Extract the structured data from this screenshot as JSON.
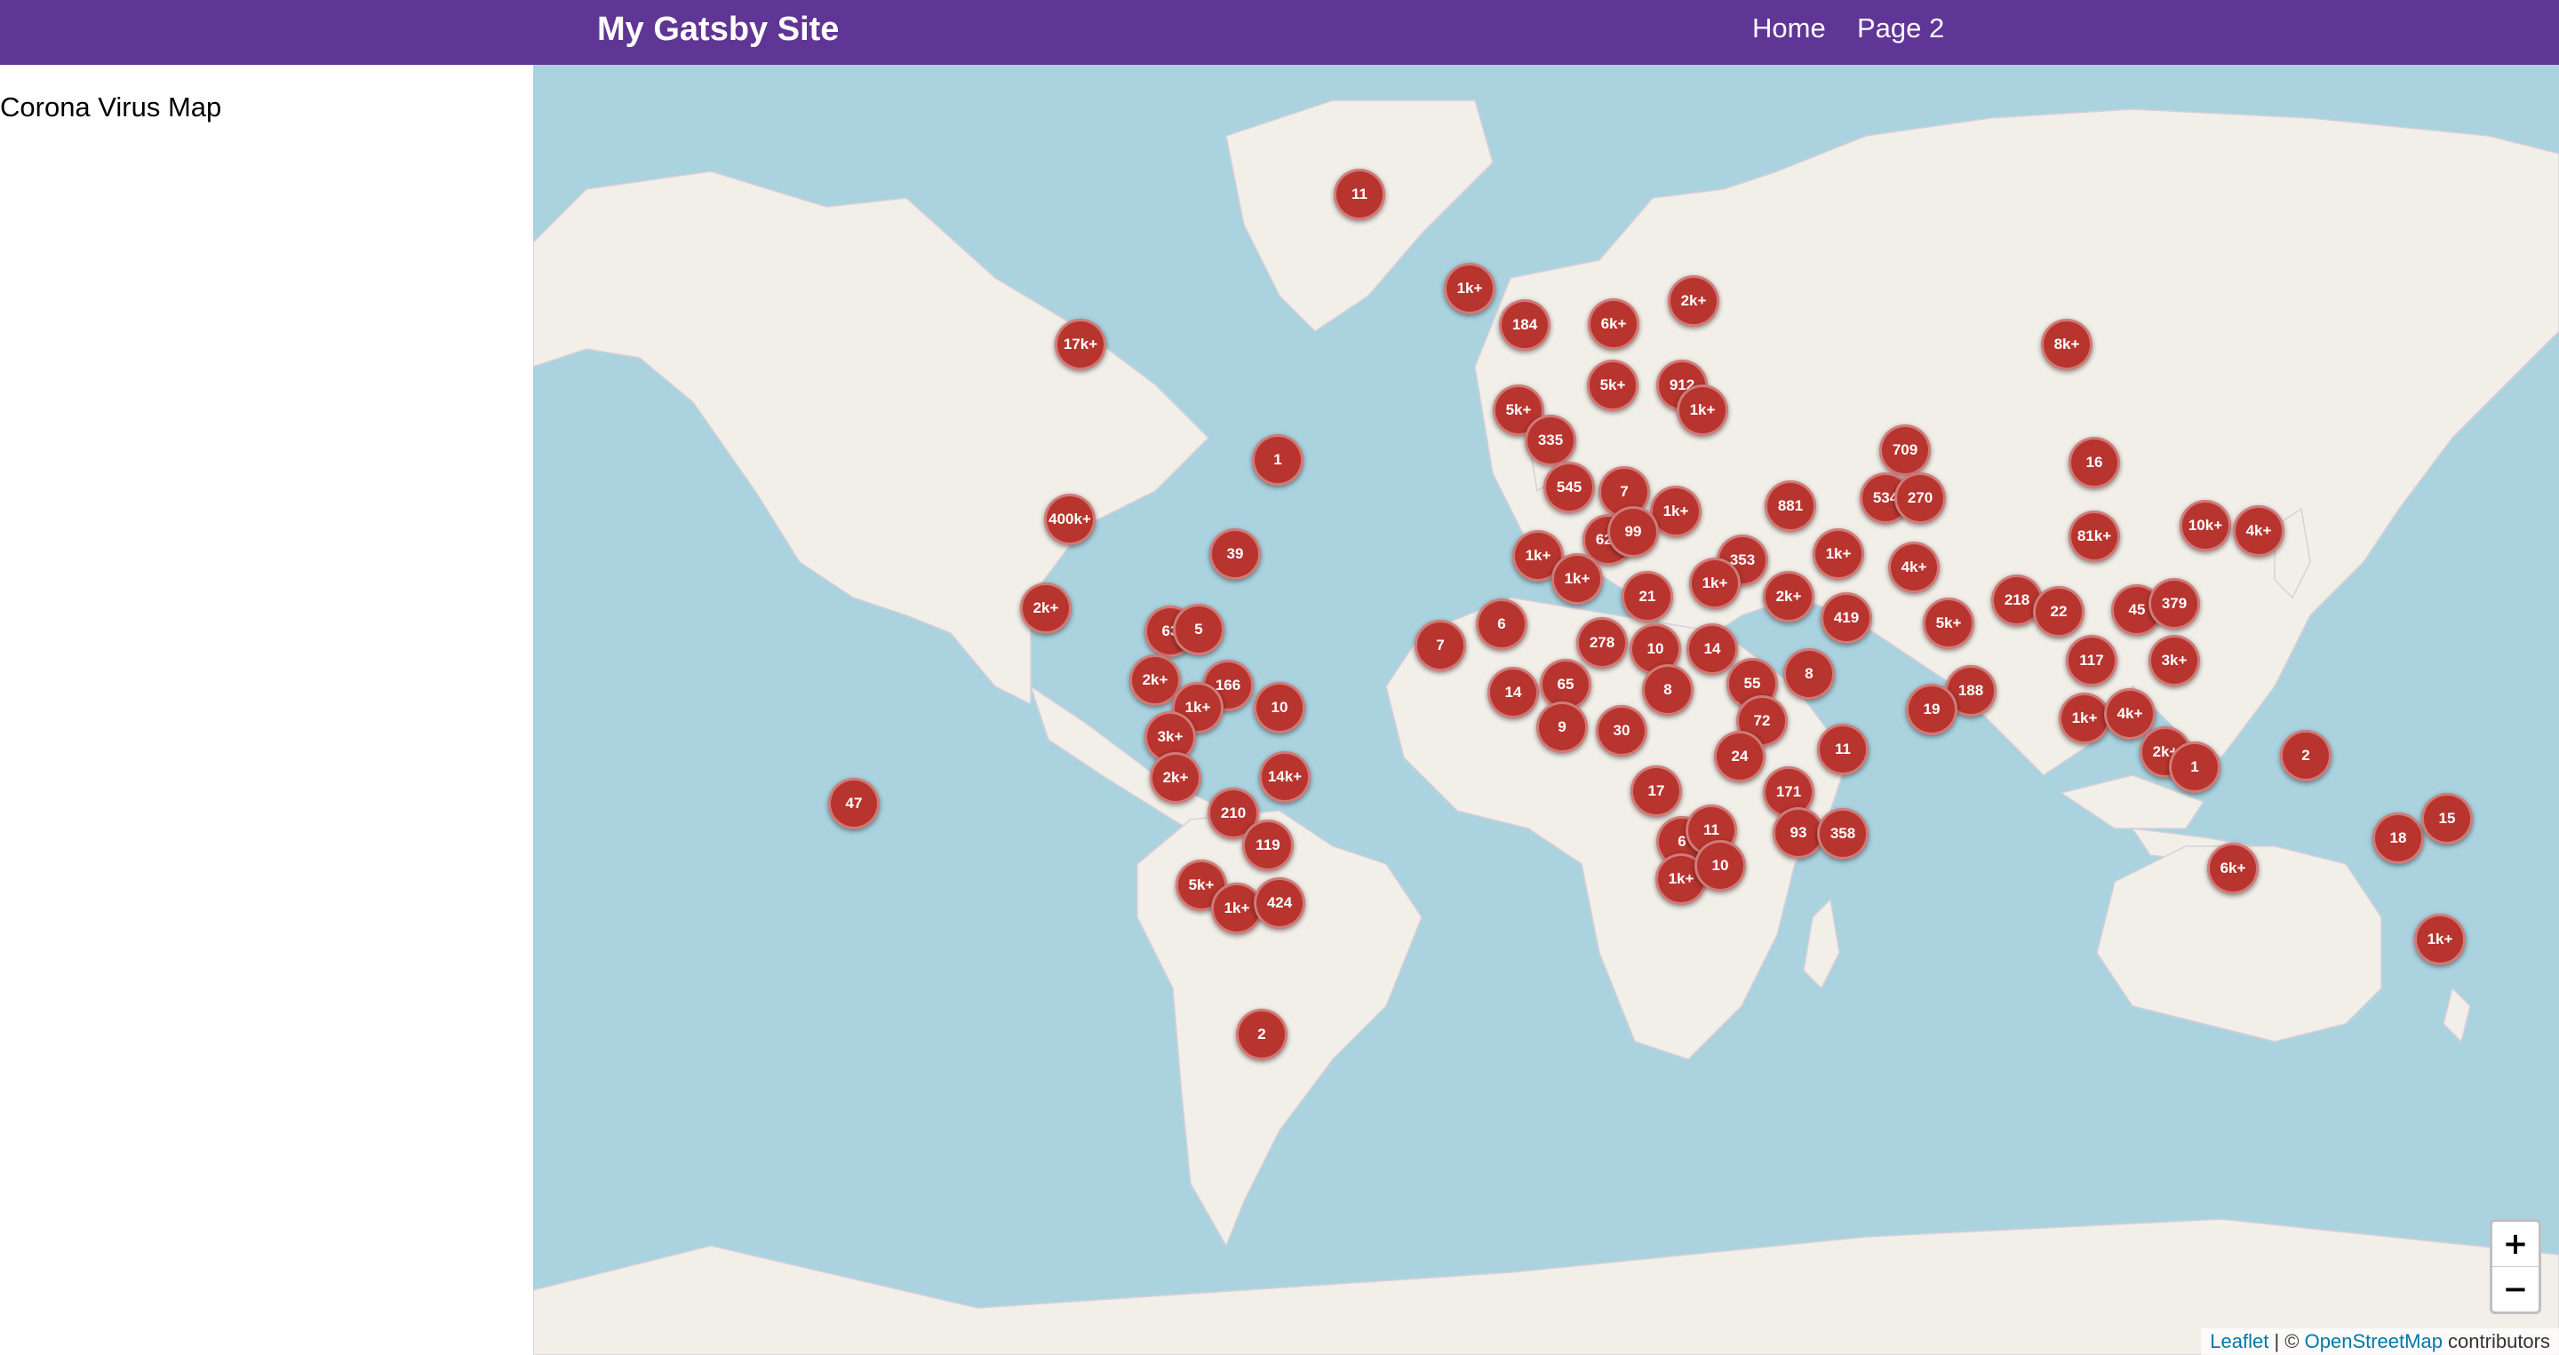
{
  "header": {
    "site_title": "My Gatsby Site",
    "nav": [
      {
        "label": "Home"
      },
      {
        "label": "Page 2"
      }
    ]
  },
  "sidebar": {
    "title": "Corona Virus Map"
  },
  "map": {
    "colors": {
      "ocean": "#aad3df",
      "land": "#f2efe9",
      "marker": "#b8342e"
    },
    "markers": [
      {
        "label": "11"
      },
      {
        "label": "1k+"
      },
      {
        "label": "184"
      },
      {
        "label": "6k+"
      },
      {
        "label": "2k+"
      },
      {
        "label": "17k+"
      },
      {
        "label": "8k+"
      },
      {
        "label": "912"
      },
      {
        "label": "5k+"
      },
      {
        "label": "5k+"
      },
      {
        "label": "1k+"
      },
      {
        "label": "1"
      },
      {
        "label": "709"
      },
      {
        "label": "16"
      },
      {
        "label": "335"
      },
      {
        "label": "545"
      },
      {
        "label": "7"
      },
      {
        "label": "534"
      },
      {
        "label": "270"
      },
      {
        "label": "400k+"
      },
      {
        "label": "881"
      },
      {
        "label": "1k+"
      },
      {
        "label": "623"
      },
      {
        "label": "99"
      },
      {
        "label": "81k+"
      },
      {
        "label": "10k+"
      },
      {
        "label": "4k+"
      },
      {
        "label": "39"
      },
      {
        "label": "1k+"
      },
      {
        "label": "353"
      },
      {
        "label": "1k+"
      },
      {
        "label": "4k+"
      },
      {
        "label": "1k+"
      },
      {
        "label": "21"
      },
      {
        "label": "1k+"
      },
      {
        "label": "2k+"
      },
      {
        "label": "218"
      },
      {
        "label": "22"
      },
      {
        "label": "45"
      },
      {
        "label": "379"
      },
      {
        "label": "2k+"
      },
      {
        "label": "63"
      },
      {
        "label": "5"
      },
      {
        "label": "419"
      },
      {
        "label": "5k+"
      },
      {
        "label": "7"
      },
      {
        "label": "6"
      },
      {
        "label": "278"
      },
      {
        "label": "10"
      },
      {
        "label": "14"
      },
      {
        "label": "8"
      },
      {
        "label": "117"
      },
      {
        "label": "3k+"
      },
      {
        "label": "2k+"
      },
      {
        "label": "166"
      },
      {
        "label": "14"
      },
      {
        "label": "65"
      },
      {
        "label": "8"
      },
      {
        "label": "55"
      },
      {
        "label": "188"
      },
      {
        "label": "1k+"
      },
      {
        "label": "10"
      },
      {
        "label": "19"
      },
      {
        "label": "1k+"
      },
      {
        "label": "4k+"
      },
      {
        "label": "3k+"
      },
      {
        "label": "9"
      },
      {
        "label": "30"
      },
      {
        "label": "72"
      },
      {
        "label": "24"
      },
      {
        "label": "11"
      },
      {
        "label": "2k+"
      },
      {
        "label": "1"
      },
      {
        "label": "2"
      },
      {
        "label": "47"
      },
      {
        "label": "2k+"
      },
      {
        "label": "14k+"
      },
      {
        "label": "17"
      },
      {
        "label": "171"
      },
      {
        "label": "210"
      },
      {
        "label": "119"
      },
      {
        "label": "6"
      },
      {
        "label": "11"
      },
      {
        "label": "93"
      },
      {
        "label": "358"
      },
      {
        "label": "18"
      },
      {
        "label": "15"
      },
      {
        "label": "5k+"
      },
      {
        "label": "1k+"
      },
      {
        "label": "424"
      },
      {
        "label": "1k+"
      },
      {
        "label": "10"
      },
      {
        "label": "6k+"
      },
      {
        "label": "1k+"
      },
      {
        "label": "2"
      }
    ],
    "zoom_in": "+",
    "zoom_out": "−",
    "attribution": {
      "leaflet": "Leaflet",
      "separator": " | © ",
      "osm": "OpenStreetMap",
      "suffix": " contributors"
    }
  }
}
